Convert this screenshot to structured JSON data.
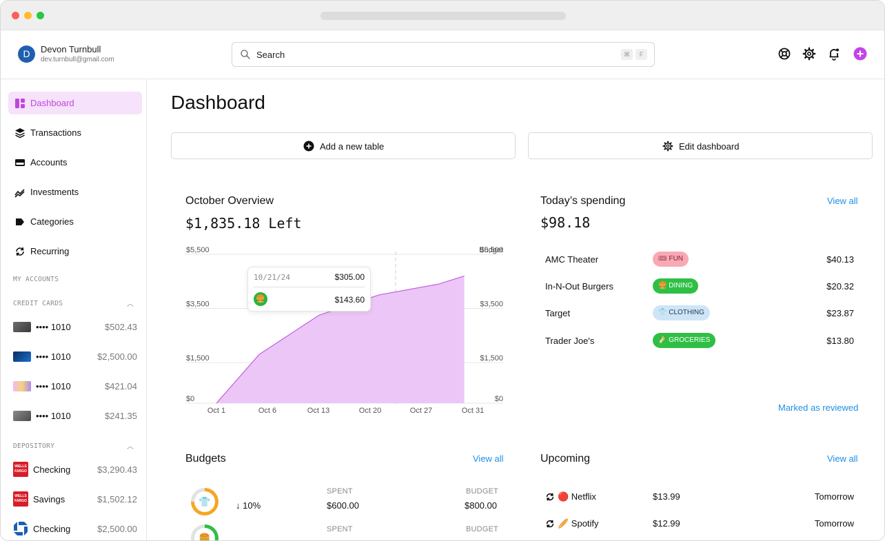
{
  "user": {
    "initial": "D",
    "name": "Devon Turnbull",
    "email": "dev.turnbull@gmail.com"
  },
  "search": {
    "label": "Search",
    "kbd1": "⌘",
    "kbd2": "F"
  },
  "sidebar": {
    "items": [
      {
        "label": "Dashboard",
        "icon": "dashboard-icon",
        "active": true
      },
      {
        "label": "Transactions",
        "icon": "layers-icon"
      },
      {
        "label": "Accounts",
        "icon": "card-icon"
      },
      {
        "label": "Investments",
        "icon": "trend-icon"
      },
      {
        "label": "Categories",
        "icon": "tag-icon"
      },
      {
        "label": "Recurring",
        "icon": "recurring-icon"
      }
    ],
    "my_accounts_label": "MY ACCOUNTS",
    "credit_cards_label": "CREDIT CARDS",
    "credit_cards": [
      {
        "name": "•••• 1010",
        "balance": "$502.43"
      },
      {
        "name": "•••• 1010",
        "balance": "$2,500.00"
      },
      {
        "name": "•••• 1010",
        "balance": "$421.04"
      },
      {
        "name": "•••• 1010",
        "balance": "$241.35"
      }
    ],
    "depository_label": "DEPOSITORY",
    "depository": [
      {
        "name": "Checking",
        "balance": "$3,290.43",
        "logo_text": "WELLS FARGO"
      },
      {
        "name": "Savings",
        "balance": "$1,502.12",
        "logo_text": "WELLS FARGO"
      },
      {
        "name": "Checking",
        "balance": "$2,500.00"
      }
    ]
  },
  "main": {
    "title": "Dashboard",
    "add_table_label": "Add a new table",
    "edit_dashboard_label": "Edit dashboard"
  },
  "overview": {
    "title": "October Overview",
    "left_amount": "$1,835.18 Left",
    "budget_label": "Budget",
    "tooltip": {
      "date": "10/21/24",
      "total": "$305.00",
      "category_value": "$143.60"
    }
  },
  "chart_data": {
    "type": "area",
    "x": [
      "Oct 1",
      "Oct 6",
      "Oct 13",
      "Oct 20",
      "Oct 27",
      "Oct 31"
    ],
    "x_days": [
      1,
      6,
      11,
      16,
      21,
      26,
      31
    ],
    "points": [
      {
        "day": 1,
        "value": 0
      },
      {
        "day": 6,
        "value": 1800
      },
      {
        "day": 13,
        "value": 3250
      },
      {
        "day": 20,
        "value": 4000
      },
      {
        "day": 27,
        "value": 4400
      },
      {
        "day": 30,
        "value": 4700
      }
    ],
    "yticks_left": [
      "$5,500",
      "$3,500",
      "$1,500",
      "$0"
    ],
    "yticks_right": [
      "$5,500",
      "$3,500",
      "$1,500",
      "$0"
    ],
    "ytick_values": [
      5500,
      3500,
      1500,
      0
    ],
    "ylim": [
      0,
      5500
    ],
    "hover_day": 21,
    "fill_color": "#ecc6f6",
    "line_color": "#c25ee0"
  },
  "today": {
    "title": "Today’s spending",
    "amount": "$98.18",
    "view_all": "View all",
    "rows": [
      {
        "merchant": "AMC Theater",
        "category": "🎟 FUN",
        "amount": "$40.13",
        "bg": "#f9a9b4",
        "fg": "#7a1f2c"
      },
      {
        "merchant": "In-N-Out Burgers",
        "category": "🍔 DINING",
        "amount": "$20.32",
        "bg": "#2fbf45",
        "fg": "#ffffff"
      },
      {
        "merchant": "Target",
        "category": "👕 CLOTHING",
        "amount": "$23.87",
        "bg": "#cfe5f7",
        "fg": "#1b3b55"
      },
      {
        "merchant": "Trader Joe's",
        "category": "🥬 GROCERIES",
        "amount": "$13.80",
        "bg": "#2fbf45",
        "fg": "#ffffff"
      }
    ],
    "marked_reviewed": "Marked as reviewed"
  },
  "budgets": {
    "title": "Budgets",
    "view_all": "View all",
    "rows": [
      {
        "change": "↓ 10%",
        "spent_label": "SPENT",
        "spent": "$600.00",
        "budget_label": "BUDGET",
        "budget": "$800.00",
        "ring_color": "#f5a623"
      },
      {
        "spent_label": "SPENT",
        "budget_label": "BUDGET",
        "ring_color": "#2fbf45"
      }
    ]
  },
  "upcoming": {
    "title": "Upcoming",
    "view_all": "View all",
    "rows": [
      {
        "name": "🔴 Netflix",
        "amount": "$13.99",
        "when": "Tomorrow"
      },
      {
        "name": "🥖 Spotify",
        "amount": "$12.99",
        "when": "Tomorrow"
      }
    ]
  }
}
